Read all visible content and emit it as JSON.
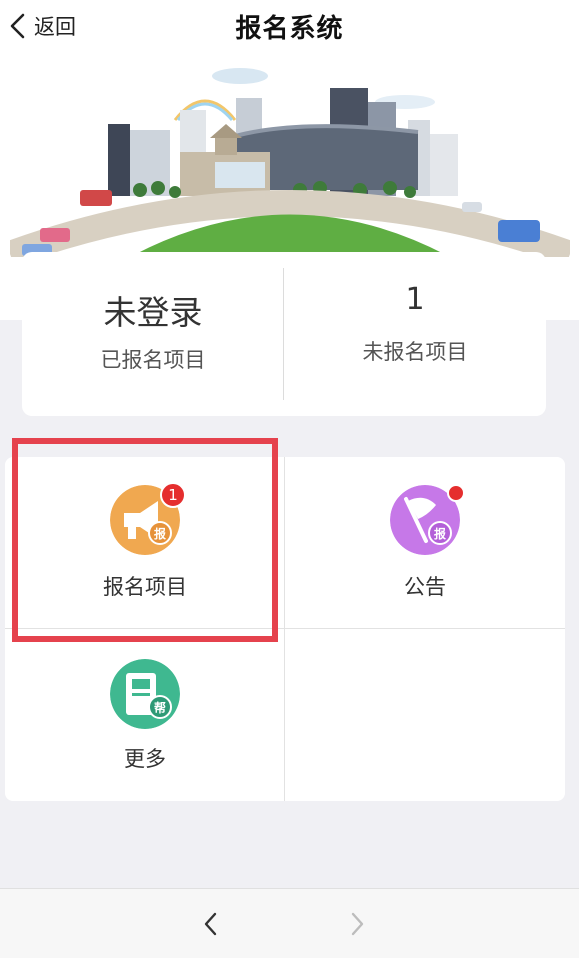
{
  "header": {
    "back_label": "返回",
    "title": "报名系统"
  },
  "stats": {
    "left": {
      "value": "未登录",
      "label": "已报名项目"
    },
    "right": {
      "value": "1",
      "label": "未报名项目"
    }
  },
  "menu": [
    {
      "label": "报名项目",
      "icon": "megaphone-icon",
      "icon_char": "报",
      "color": "#f0a850",
      "badge": "1"
    },
    {
      "label": "公告",
      "icon": "flag-icon",
      "icon_char": "报",
      "color": "#c678e8",
      "badge_dot": true
    },
    {
      "label": "更多",
      "icon": "book-icon",
      "icon_char": "帮",
      "color": "#3fb890"
    }
  ],
  "colors": {
    "highlight": "#e5424d",
    "badge": "#e52e2e"
  }
}
